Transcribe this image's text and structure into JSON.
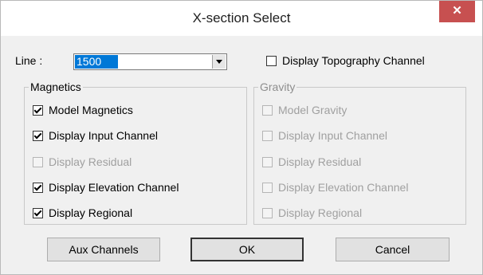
{
  "window": {
    "title": "X-section Select",
    "close_glyph": "✕"
  },
  "line": {
    "label": "Line :",
    "value": "1500"
  },
  "topo": {
    "label": "Display Topography Channel",
    "checked": false
  },
  "magnetics": {
    "title": "Magnetics",
    "items": [
      {
        "label": "Model Magnetics",
        "checked": true,
        "enabled": true
      },
      {
        "label": "Display Input Channel",
        "checked": true,
        "enabled": true
      },
      {
        "label": "Display Residual",
        "checked": false,
        "enabled": false
      },
      {
        "label": "Display Elevation Channel",
        "checked": true,
        "enabled": true
      },
      {
        "label": "Display Regional",
        "checked": true,
        "enabled": true
      }
    ]
  },
  "gravity": {
    "title": "Gravity",
    "items": [
      {
        "label": "Model Gravity",
        "checked": false,
        "enabled": false
      },
      {
        "label": "Display Input Channel",
        "checked": false,
        "enabled": false
      },
      {
        "label": "Display Residual",
        "checked": false,
        "enabled": false
      },
      {
        "label": "Display Elevation Channel",
        "checked": false,
        "enabled": false
      },
      {
        "label": "Display Regional",
        "checked": false,
        "enabled": false
      }
    ]
  },
  "buttons": {
    "aux": "Aux Channels",
    "ok": "OK",
    "cancel": "Cancel"
  }
}
